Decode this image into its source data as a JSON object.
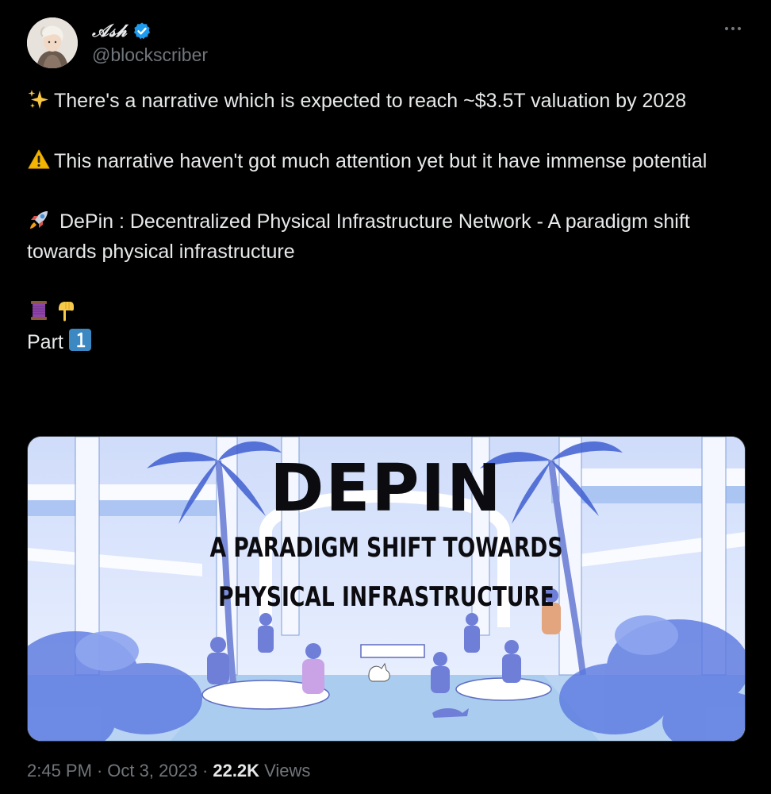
{
  "author": {
    "display_name": "𝒜𝓈𝒽",
    "handle": "@blockscriber",
    "verified": true,
    "avatar_icon": "profile-illustration"
  },
  "menu": {
    "more_icon": "more-horizontal-icon"
  },
  "tweet": {
    "lines": [
      {
        "emoji": "sparkles-icon",
        "text": "There's a narrative which is expected to reach ~$3.5T valuation by 2028"
      },
      {
        "emoji": "warning-icon",
        "text": "This narrative haven't got much attention yet but it have immense potential"
      },
      {
        "emoji": "rocket-icon",
        "text": " DePin : Decentralized Physical Infrastructure Network - A paradigm shift towards physical infrastructure"
      }
    ],
    "thread_emojis": [
      "thread-icon",
      "pointing-down-icon"
    ],
    "part_label": "Part",
    "part_number_emoji": "keycap-one-icon"
  },
  "media": {
    "title": "DEPIN",
    "subtitle_line1": "A PARADIGM SHIFT TOWARDS",
    "subtitle_line2": "PHYSICAL INFRASTRUCTURE"
  },
  "meta": {
    "time": "2:45 PM",
    "date": "Oct 3, 2023",
    "separator": "·",
    "views_count": "22.2K",
    "views_label": "Views"
  },
  "colors": {
    "background": "#000000",
    "text": "#e7e9ea",
    "secondary_text": "#71767b",
    "verified": "#1d9bf0"
  }
}
